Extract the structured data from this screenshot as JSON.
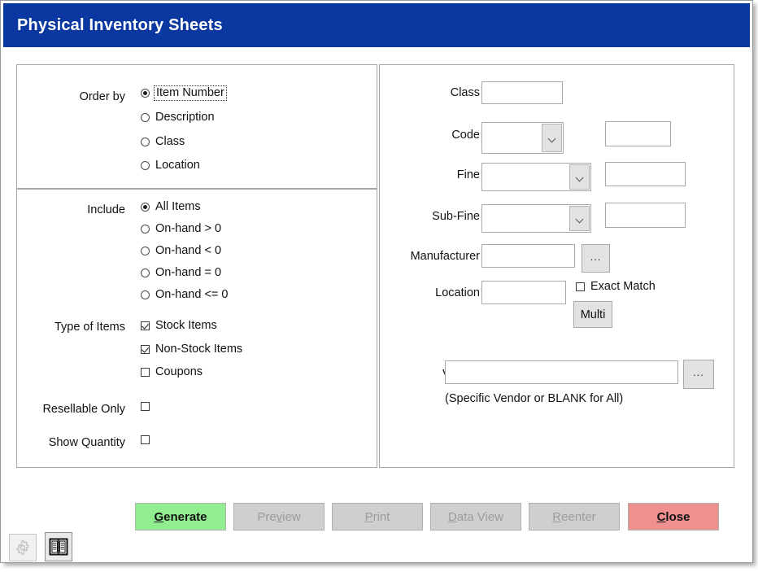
{
  "window": {
    "title": "Physical Inventory Sheets",
    "title_bar_color": "#0a37a0"
  },
  "order_by": {
    "label": "Order by",
    "options": [
      {
        "label": "Item Number",
        "checked": true,
        "focused": true
      },
      {
        "label": "Description",
        "checked": false,
        "focused": false
      },
      {
        "label": "Class",
        "checked": false,
        "focused": false
      },
      {
        "label": "Location",
        "checked": false,
        "focused": false
      }
    ]
  },
  "include": {
    "label": "Include",
    "options": [
      {
        "label": "All Items",
        "checked": true
      },
      {
        "label": "On-hand > 0",
        "checked": false
      },
      {
        "label": "On-hand < 0",
        "checked": false
      },
      {
        "label": "On-hand = 0",
        "checked": false
      },
      {
        "label": "On-hand <= 0",
        "checked": false
      }
    ]
  },
  "type_of_items": {
    "label": "Type of Items",
    "options": [
      {
        "label": "Stock Items",
        "checked": true
      },
      {
        "label": "Non-Stock Items",
        "checked": true
      },
      {
        "label": "Coupons",
        "checked": false
      }
    ]
  },
  "resellable_only": {
    "label": "Resellable Only",
    "checked": false
  },
  "show_quantity": {
    "label": "Show Quantity",
    "checked": false
  },
  "filters": {
    "class": {
      "label": "Class",
      "value": ""
    },
    "code": {
      "label": "Code",
      "value": "",
      "secondary_value": ""
    },
    "fine": {
      "label": "Fine",
      "value": "",
      "secondary_value": ""
    },
    "sub_fine": {
      "label": "Sub-Fine",
      "value": "",
      "secondary_value": ""
    },
    "manufacturer": {
      "label": "Manufacturer",
      "value": "",
      "browse_label": "..."
    },
    "location": {
      "label": "Location",
      "value": ""
    },
    "exact_match": {
      "label": "Exact Match",
      "checked": false
    },
    "multi_button": {
      "label": "Multi"
    },
    "vendor": {
      "label": "Vendor",
      "value": "",
      "browse_label": "...",
      "hint": "(Specific Vendor or BLANK for All)"
    }
  },
  "buttons": {
    "generate": {
      "label": "Generate",
      "mnemonic": "G",
      "rest": "enerate",
      "color": "#90ee90",
      "disabled": false
    },
    "preview": {
      "label": "Preview",
      "mnemonic": "v",
      "color": "#cfcfcf",
      "disabled": true
    },
    "print": {
      "label": "Print",
      "mnemonic": "P",
      "color": "#cfcfcf",
      "disabled": true
    },
    "data_view": {
      "label": "Data View",
      "mnemonic": "D",
      "color": "#cfcfcf",
      "disabled": true
    },
    "reenter": {
      "label": "Reenter",
      "mnemonic": "R",
      "color": "#cfcfcf",
      "disabled": true
    },
    "close": {
      "label": "Close",
      "mnemonic": "C",
      "rest": "lose",
      "color": "#ee9090",
      "disabled": false
    }
  },
  "taskbar": {
    "gear_icon": "gear-icon",
    "book_icon": "book-icon"
  }
}
